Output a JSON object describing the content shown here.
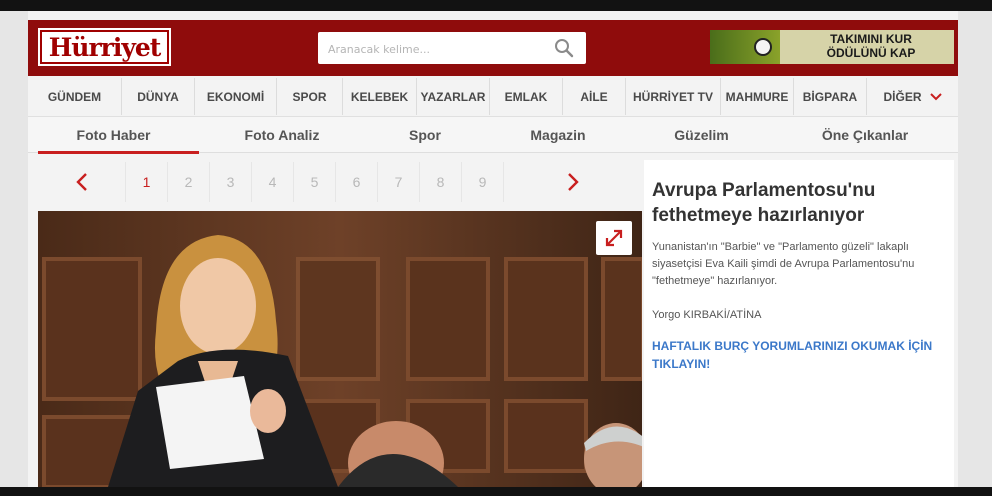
{
  "header": {
    "logo_text": "Hürriyet",
    "search": {
      "placeholder": "Aranacak kelime..."
    },
    "banner": {
      "line1": "TAKIMINI KUR",
      "line2": "ÖDÜLÜNÜ KAP"
    }
  },
  "main_nav": {
    "items": [
      {
        "label": "GÜNDEM"
      },
      {
        "label": "DÜNYA"
      },
      {
        "label": "EKONOMİ"
      },
      {
        "label": "SPOR"
      },
      {
        "label": "KELEBEK"
      },
      {
        "label": "YAZARLAR"
      },
      {
        "label": "EMLAK"
      },
      {
        "label": "AİLE"
      },
      {
        "label": "HÜRRİYET TV"
      },
      {
        "label": "MAHMURE"
      },
      {
        "label": "BİGPARA"
      },
      {
        "label": "DİĞER"
      }
    ]
  },
  "sub_nav": {
    "tabs": [
      {
        "label": "Foto Haber"
      },
      {
        "label": "Foto Analiz"
      },
      {
        "label": "Spor"
      },
      {
        "label": "Magazin"
      },
      {
        "label": "Güzelim"
      },
      {
        "label": "Öne Çıkanlar"
      }
    ]
  },
  "pagination": {
    "pages": [
      "1",
      "2",
      "3",
      "4",
      "5",
      "6",
      "7",
      "8",
      "9"
    ],
    "current": "1"
  },
  "article": {
    "title": "Avrupa Parlamentosu'nu fethetmeye hazırlanıyor",
    "summary": "Yunanistan'ın \"Barbie\" ve \"Parlamento güzeli\" lakaplı siyasetçisi Eva Kaili şimdi de Avrupa Parlamentosu'nu \"fethetmeye\" hazırlanıyor.",
    "author": "Yorgo KIRBAKİ/ATİNA",
    "promo_link": "HAFTALIK BURÇ YORUMLARINIZI OKUMAK İÇİN TIKLAYIN!"
  },
  "colors": {
    "brand_red": "#8f0c0c",
    "accent_red": "#c81f1f",
    "link_blue": "#3b78c9"
  }
}
